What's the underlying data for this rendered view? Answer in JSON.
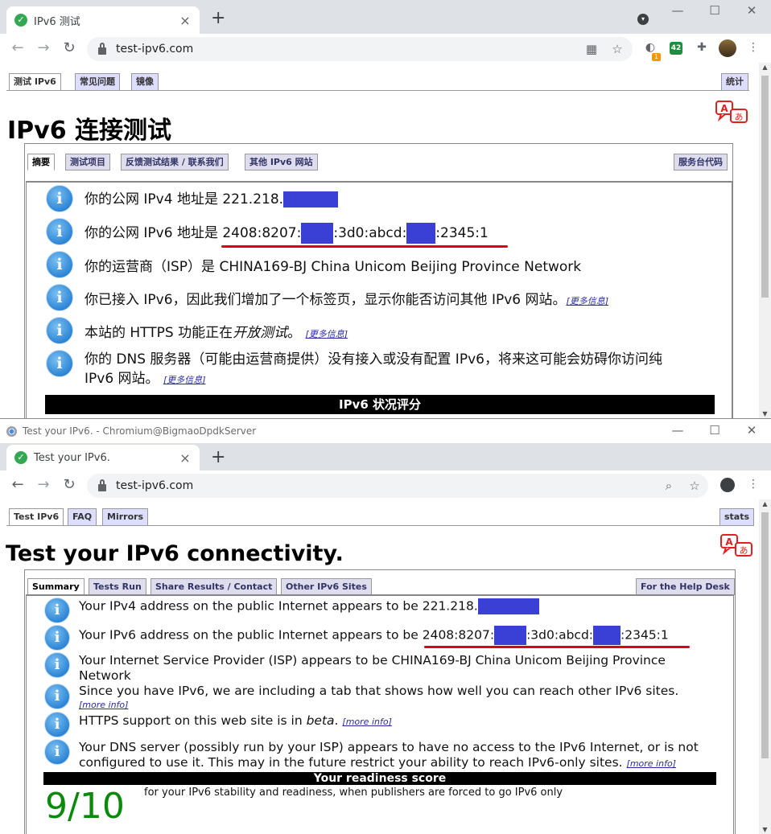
{
  "top_window": {
    "tab_title": "IPv6 测试",
    "url": "test-ipv6.com",
    "ext_badge": "1",
    "ext_count": "42",
    "top_tabs": [
      "测试 IPv6",
      "常见问题",
      "镜像"
    ],
    "stats_tab": "统计",
    "heading": "IPv6 连接测试",
    "sub_tabs": [
      "摘要",
      "测试项目",
      "反馈测试结果 / 联系我们",
      "其他 IPv6 网站"
    ],
    "helpdesk_tab": "服务台代码",
    "rows": {
      "ipv4_prefix": "你的公网 IPv4 地址是 221.218.",
      "ipv6_prefix": "你的公网 IPv6 地址是 2408:8207:",
      "ipv6_mid": ":3d0:abcd:",
      "ipv6_end": ":2345:1",
      "isp": "你的运营商（ISP）是 CHINA169-BJ China Unicom Beijing Province Network",
      "ipv6_tab": "你已接入 IPv6，因此我们增加了一个标签页，显示你能否访问其他 IPv6 网站。",
      "https_prefix": "本站的 HTTPS 功能正在",
      "https_em": "开放测试",
      "https_suffix": "。",
      "dns_line1": "你的 DNS 服务器（可能由运营商提供）没有接入或没有配置 IPv6，将来这可能会妨碍你访问纯",
      "dns_line2": "IPv6 网站。",
      "more": "[更多信息]"
    },
    "bar_title": "IPv6 状况评分"
  },
  "bottom_window": {
    "window_title": "Test your IPv6. - Chromium@BigmaoDpdkServer",
    "tab_title": "Test your IPv6.",
    "url": "test-ipv6.com",
    "top_tabs": [
      "Test IPv6",
      "FAQ",
      "Mirrors"
    ],
    "stats_tab": "stats",
    "heading": "Test your IPv6 connectivity.",
    "sub_tabs": [
      "Summary",
      "Tests Run",
      "Share Results / Contact",
      "Other IPv6 Sites"
    ],
    "helpdesk_tab": "For the Help Desk",
    "rows": {
      "ipv4_prefix": "Your IPv4 address on the public Internet appears to be 221.218.",
      "ipv6_prefix": "Your IPv6 address on the public Internet appears to be 2408:8207:",
      "ipv6_mid": ":3d0:abcd:",
      "ipv6_end": ":2345:1",
      "isp_line1": "Your Internet Service Provider (ISP) appears to be CHINA169-BJ China Unicom Beijing Province",
      "isp_line2": "Network",
      "ipv6_tab": "Since you have IPv6, we are including a tab that shows how well you can reach other IPv6 sites.",
      "https_prefix": "HTTPS support on this web site is in ",
      "https_em": "beta",
      "https_suffix": ".",
      "dns_line1": "Your DNS server (possibly run by your ISP) appears to have no access to the IPv6 Internet, or is not",
      "dns_line2": "configured to use it. This may in the future restrict your ability to reach IPv6-only sites.",
      "more": "[more info]"
    },
    "bar_title": "Your readiness score",
    "score": "9/10",
    "score_desc": "for your IPv6 stability and readiness, when publishers are forced to go IPv6 only"
  }
}
